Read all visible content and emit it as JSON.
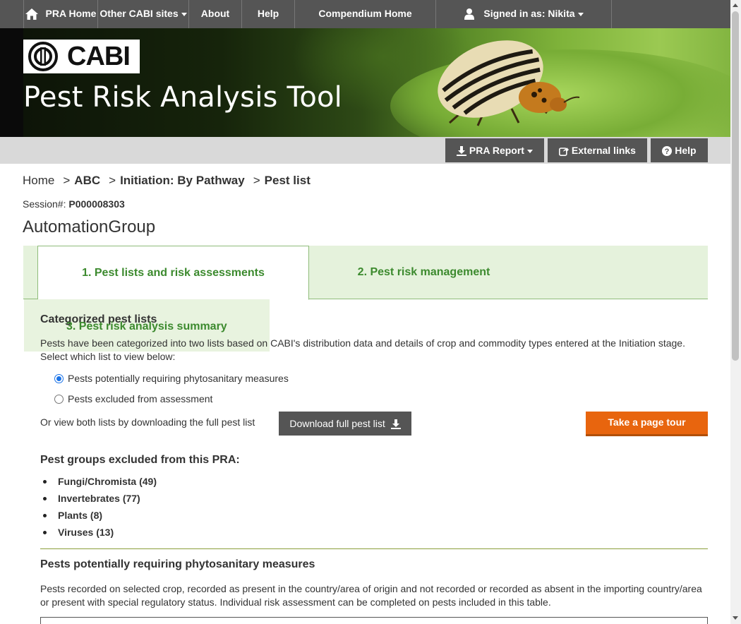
{
  "topnav": {
    "pra_home": "PRA Home",
    "other_sites": "Other CABI sites",
    "about": "About",
    "help": "Help",
    "compendium_home": "Compendium Home",
    "signed_in": "Signed in as: Nikita"
  },
  "banner": {
    "logo_text": "CABI",
    "title": "Pest Risk Analysis Tool"
  },
  "toolbar": {
    "pra_report": "PRA Report",
    "external_links": "External links",
    "help": "Help"
  },
  "breadcrumb": {
    "home": "Home",
    "abc": "ABC",
    "initiation": "Initiation: By Pathway",
    "current": "Pest list"
  },
  "session": {
    "label": "Session#:",
    "id": "P000008303"
  },
  "group_name": "AutomationGroup",
  "tabs": {
    "tab1": "1. Pest lists and risk assessments",
    "tab2": "2. Pest risk management",
    "tab3": "3. Pest risk analysis summary"
  },
  "categorized": {
    "title": "Categorized pest lists",
    "description": "Pests have been categorized into two lists based on CABI's distribution data and details of crop and commodity types entered at the Initiation stage. Select which list to view below:",
    "option1": "Pests potentially requiring phytosanitary measures",
    "option2": "Pests excluded from assessment",
    "selected": "option1",
    "download_text": "Or view both lists by downloading the full pest list",
    "download_button": "Download full pest list",
    "tour_button": "Take a page tour"
  },
  "excluded_groups": {
    "title": "Pest groups excluded from this PRA:",
    "items": [
      "Fungi/Chromista (49)",
      "Invertebrates (77)",
      "Plants (8)",
      "Viruses (13)"
    ]
  },
  "phyto_section": {
    "title": "Pests potentially requiring phytosanitary measures",
    "description": "Pests recorded on selected crop, recorded as present in the country/area of origin and not recorded or recorded as absent in the importing country/area or present with special regulatory status. Individual risk assessment can be completed on pests included in this table."
  },
  "colors": {
    "nav_bg": "#555555",
    "tab_green_bg": "#e5f2dc",
    "tab_green_text": "#3c8a2e",
    "tour_orange": "#e8650e"
  }
}
